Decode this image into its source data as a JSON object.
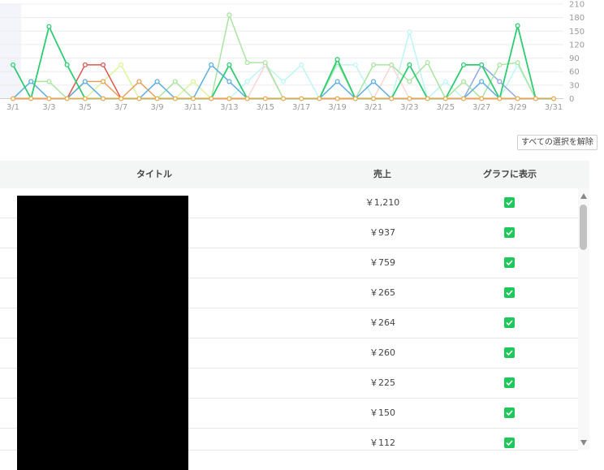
{
  "chart_data": {
    "type": "line",
    "x": [
      "3/1",
      "3/2",
      "3/3",
      "3/4",
      "3/5",
      "3/6",
      "3/7",
      "3/8",
      "3/9",
      "3/10",
      "3/11",
      "3/12",
      "3/13",
      "3/14",
      "3/15",
      "3/16",
      "3/17",
      "3/18",
      "3/19",
      "3/20",
      "3/21",
      "3/22",
      "3/23",
      "3/24",
      "3/25",
      "3/26",
      "3/27",
      "3/28",
      "3/29",
      "3/30",
      "3/31"
    ],
    "x_tick_labels": [
      "3/1",
      "3/3",
      "3/5",
      "3/7",
      "3/9",
      "3/11",
      "3/13",
      "3/15",
      "3/17",
      "3/19",
      "3/21",
      "3/23",
      "3/25",
      "3/27",
      "3/29",
      "3/31"
    ],
    "y_ticks": [
      "0",
      "30",
      "60",
      "90",
      "120",
      "150",
      "180",
      "210"
    ],
    "ylim": [
      0,
      210
    ],
    "grid": true,
    "legend": "none",
    "series": [
      {
        "color": "#2ecc71",
        "values": [
          75,
          0,
          160,
          75,
          0,
          0,
          0,
          0,
          0,
          0,
          0,
          0,
          75,
          0,
          0,
          0,
          0,
          0,
          87,
          0,
          0,
          0,
          75,
          0,
          0,
          75,
          75,
          0,
          162,
          0,
          0
        ]
      },
      {
        "color": "#5dade2",
        "values": [
          0,
          38,
          0,
          0,
          38,
          0,
          0,
          0,
          38,
          0,
          0,
          75,
          38,
          0,
          0,
          0,
          0,
          0,
          38,
          0,
          38,
          0,
          0,
          0,
          0,
          0,
          38,
          0,
          0,
          0,
          0
        ]
      },
      {
        "color": "#a9e5a0",
        "values": [
          0,
          38,
          38,
          0,
          0,
          0,
          0,
          0,
          0,
          38,
          0,
          0,
          186,
          80,
          80,
          0,
          0,
          0,
          80,
          0,
          75,
          75,
          38,
          80,
          0,
          38,
          0,
          75,
          80,
          0,
          0
        ]
      },
      {
        "color": "#e05555",
        "values": [
          0,
          0,
          0,
          0,
          75,
          75,
          0,
          0,
          0,
          0,
          0,
          0,
          0,
          0,
          0,
          0,
          0,
          0,
          0,
          0,
          0,
          0,
          0,
          0,
          0,
          0,
          0,
          0,
          0,
          0,
          0
        ]
      },
      {
        "color": "#e8a05a",
        "values": [
          0,
          0,
          0,
          0,
          38,
          38,
          0,
          38,
          0,
          0,
          0,
          0,
          0,
          0,
          0,
          0,
          0,
          0,
          0,
          0,
          0,
          0,
          0,
          0,
          0,
          0,
          0,
          0,
          0,
          0,
          0
        ]
      },
      {
        "color": "#dcf59a",
        "values": [
          0,
          0,
          0,
          0,
          0,
          38,
          75,
          0,
          0,
          0,
          38,
          0,
          0,
          0,
          0,
          0,
          0,
          0,
          0,
          0,
          0,
          0,
          0,
          0,
          0,
          0,
          0,
          0,
          0,
          0,
          0
        ]
      },
      {
        "color": "#bff5f5",
        "values": [
          0,
          0,
          0,
          0,
          0,
          0,
          0,
          0,
          0,
          0,
          0,
          0,
          0,
          38,
          75,
          38,
          75,
          0,
          75,
          75,
          0,
          0,
          148,
          0,
          38,
          0,
          0,
          0,
          75,
          0,
          0
        ]
      },
      {
        "color": "#fbd5d5",
        "values": [
          0,
          0,
          0,
          0,
          0,
          0,
          0,
          0,
          0,
          0,
          0,
          0,
          0,
          0,
          75,
          0,
          0,
          0,
          0,
          0,
          0,
          75,
          0,
          0,
          0,
          0,
          0,
          0,
          0,
          0,
          0
        ]
      },
      {
        "color": "#8fa9e8",
        "values": [
          0,
          0,
          0,
          0,
          0,
          0,
          0,
          0,
          0,
          0,
          0,
          0,
          0,
          0,
          0,
          0,
          0,
          0,
          0,
          0,
          0,
          0,
          0,
          0,
          0,
          0,
          75,
          38,
          0,
          0,
          0
        ]
      }
    ],
    "zero_series_color": "#e8a84a"
  },
  "clear_selection_label": "すべての選択を解除",
  "table": {
    "headers": {
      "title": "タイトル",
      "sales": "売上",
      "show": "グラフに表示"
    },
    "rows": [
      {
        "sales": "￥1,210"
      },
      {
        "sales": "￥937"
      },
      {
        "sales": "￥759"
      },
      {
        "sales": "￥265"
      },
      {
        "sales": "￥264"
      },
      {
        "sales": "￥260"
      },
      {
        "sales": "￥225"
      },
      {
        "sales": "￥150"
      },
      {
        "sales": "￥112"
      }
    ]
  },
  "colors": {
    "accent": "#1ec85a",
    "header_bg": "#f4f6f6"
  }
}
